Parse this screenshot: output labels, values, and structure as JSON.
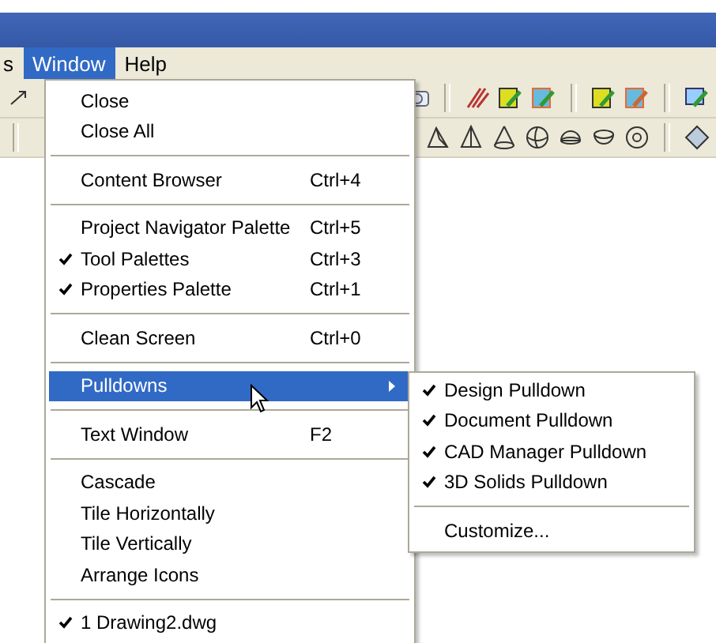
{
  "menu_bar": [
    {
      "label": "s",
      "selected": false
    },
    {
      "label": "Window",
      "selected": true
    },
    {
      "label": "Help",
      "selected": false
    }
  ],
  "window_menu": {
    "groups": [
      [
        {
          "label": "Close",
          "checked": false,
          "selected": false
        },
        {
          "label": "Close All",
          "checked": false,
          "selected": false
        }
      ],
      [
        {
          "label": "Content Browser",
          "shortcut": "Ctrl+4",
          "checked": false,
          "selected": false
        }
      ],
      [
        {
          "label": "Project Navigator Palette",
          "shortcut": "Ctrl+5",
          "checked": false,
          "selected": false
        },
        {
          "label": "Tool Palettes",
          "shortcut": "Ctrl+3",
          "checked": true,
          "selected": false
        },
        {
          "label": "Properties Palette",
          "shortcut": "Ctrl+1",
          "checked": true,
          "selected": false
        }
      ],
      [
        {
          "label": "Clean Screen",
          "shortcut": "Ctrl+0",
          "checked": false,
          "selected": false
        }
      ],
      [
        {
          "label": "Pulldowns",
          "checked": false,
          "selected": true,
          "submenu": true
        }
      ],
      [
        {
          "label": "Text Window",
          "shortcut": "F2",
          "checked": false,
          "selected": false
        }
      ],
      [
        {
          "label": "Cascade",
          "checked": false,
          "selected": false
        },
        {
          "label": "Tile Horizontally",
          "checked": false,
          "selected": false
        },
        {
          "label": "Tile Vertically",
          "checked": false,
          "selected": false
        },
        {
          "label": "Arrange Icons",
          "checked": false,
          "selected": false
        }
      ],
      [
        {
          "label": "1 Drawing2.dwg",
          "checked": true,
          "selected": false
        }
      ]
    ]
  },
  "pulldowns_submenu": {
    "groups": [
      [
        {
          "label": "Design Pulldown",
          "checked": true
        },
        {
          "label": "Document Pulldown",
          "checked": true
        },
        {
          "label": "CAD Manager Pulldown",
          "checked": true
        },
        {
          "label": "3D Solids Pulldown",
          "checked": true
        }
      ],
      [
        {
          "label": "Customize...",
          "checked": false
        }
      ]
    ]
  }
}
